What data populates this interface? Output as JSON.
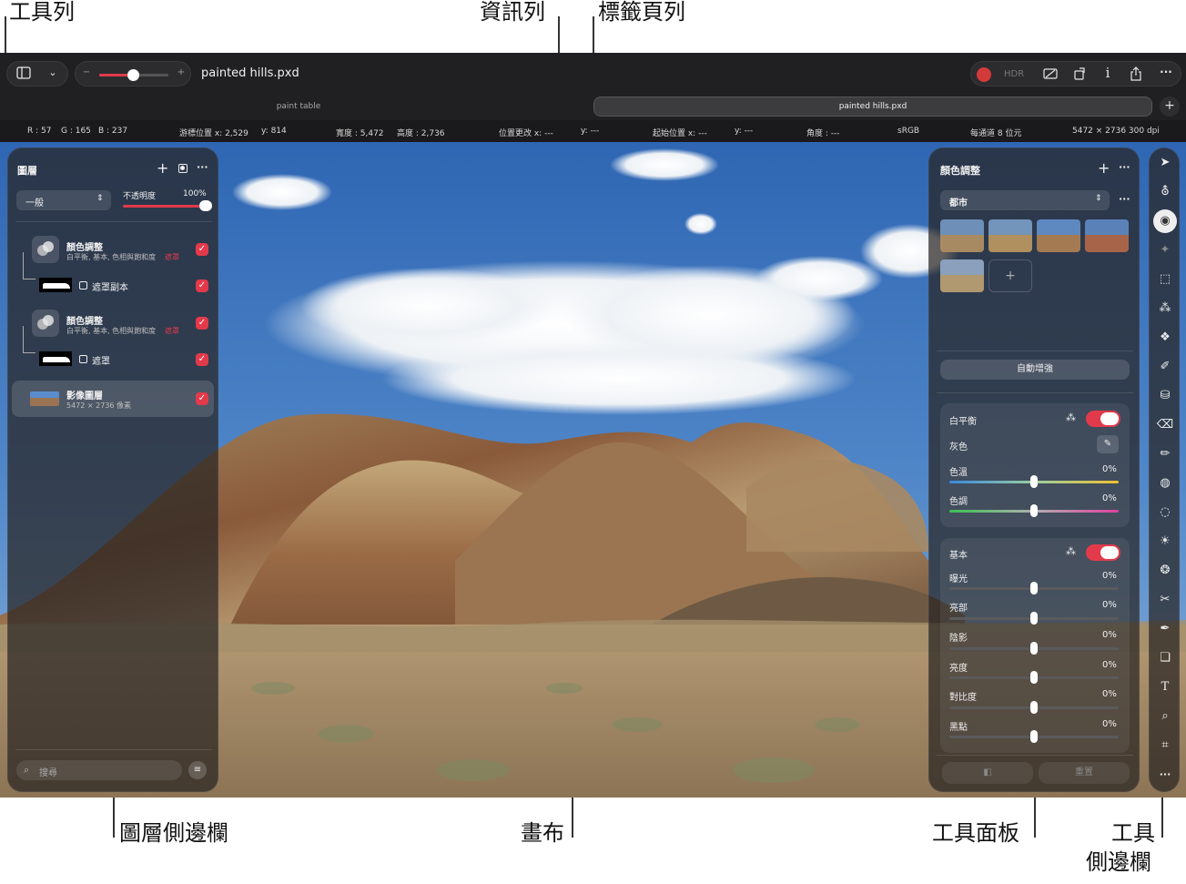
{
  "callouts": {
    "toolbar": "工具列",
    "infobar": "資訊列",
    "tabbar": "標籤頁列",
    "layers_sidebar": "圖層側邊欄",
    "canvas": "畫布",
    "tools_panel": "工具面板",
    "tools_sidebar_1": "工具",
    "tools_sidebar_2": "側邊欄"
  },
  "toolbar": {
    "filename": "painted hills.pxd",
    "zoom_minus": "−",
    "zoom_plus": "+",
    "hdr": "HDR",
    "info": "i",
    "more": "···"
  },
  "tabs": [
    {
      "label": "paint table",
      "active": false
    },
    {
      "label": "painted hills.pxd",
      "active": true
    }
  ],
  "tab_add": "+",
  "infobar": {
    "r": "R : 57",
    "g": "G : 165",
    "b": "B : 237",
    "cursor_x": "游標位置 x: 2,529",
    "cursor_y": "y: 814",
    "width": "寬度 : 5,472",
    "height": "高度 : 2,736",
    "delta_x": "位置更改 x: ---",
    "delta_y": "y: ---",
    "start_x": "起始位置 x: ---",
    "start_y": "y: ---",
    "angle": "角度 : ---",
    "colorspace": "sRGB",
    "depth": "每通道 8 位元",
    "size": "5472 × 2736 300 dpi"
  },
  "layers": {
    "title": "圖層",
    "blend_mode": "一般",
    "opacity_label": "不透明度",
    "opacity_value": "100%",
    "opacity_fraction": 1.0,
    "items": [
      {
        "name": "顏色調整",
        "sub": "白平衡, 基本, 色相與飽和度",
        "tag": "遮罩"
      },
      {
        "name": "遮罩副本"
      },
      {
        "name": "顏色調整",
        "sub": "白平衡, 基本, 色相與飽和度",
        "tag": "遮罩"
      },
      {
        "name": "遮罩"
      },
      {
        "name": "影像圖層",
        "sub": "5472 × 2736 像素"
      }
    ],
    "search_placeholder": "搜尋"
  },
  "adjust": {
    "title": "顏色調整",
    "preset": "都市",
    "auto_enhance": "自動增強",
    "wb": {
      "title": "白平衡",
      "gray": "灰色",
      "temp_label": "色溫",
      "temp_value": "0%",
      "tint_label": "色調",
      "tint_value": "0%"
    },
    "basic": {
      "title": "基本",
      "rows": [
        {
          "label": "曝光",
          "value": "0%"
        },
        {
          "label": "亮部",
          "value": "0%"
        },
        {
          "label": "陰影",
          "value": "0%"
        },
        {
          "label": "亮度",
          "value": "0%"
        },
        {
          "label": "對比度",
          "value": "0%"
        },
        {
          "label": "黑點",
          "value": "0%"
        }
      ]
    },
    "reset": "重置"
  },
  "colors": {
    "accent": "#e23a4b",
    "app_bg": "#1c1c1e",
    "sky": "#3f78c0"
  },
  "tool_icons": [
    "arrow-pointer-icon",
    "paint-bucket-icon",
    "color-adjust-icon",
    "effects-icon",
    "marquee-icon",
    "magic-wand-icon",
    "quick-selection-icon",
    "brush-icon",
    "fill-icon",
    "eraser-icon",
    "pencil-icon",
    "smudge-icon",
    "blur-icon",
    "lighten-icon",
    "clone-icon",
    "repair-icon",
    "pen-icon",
    "shapes-icon",
    "text-icon",
    "zoom-icon",
    "crop-icon",
    "more-icon"
  ]
}
